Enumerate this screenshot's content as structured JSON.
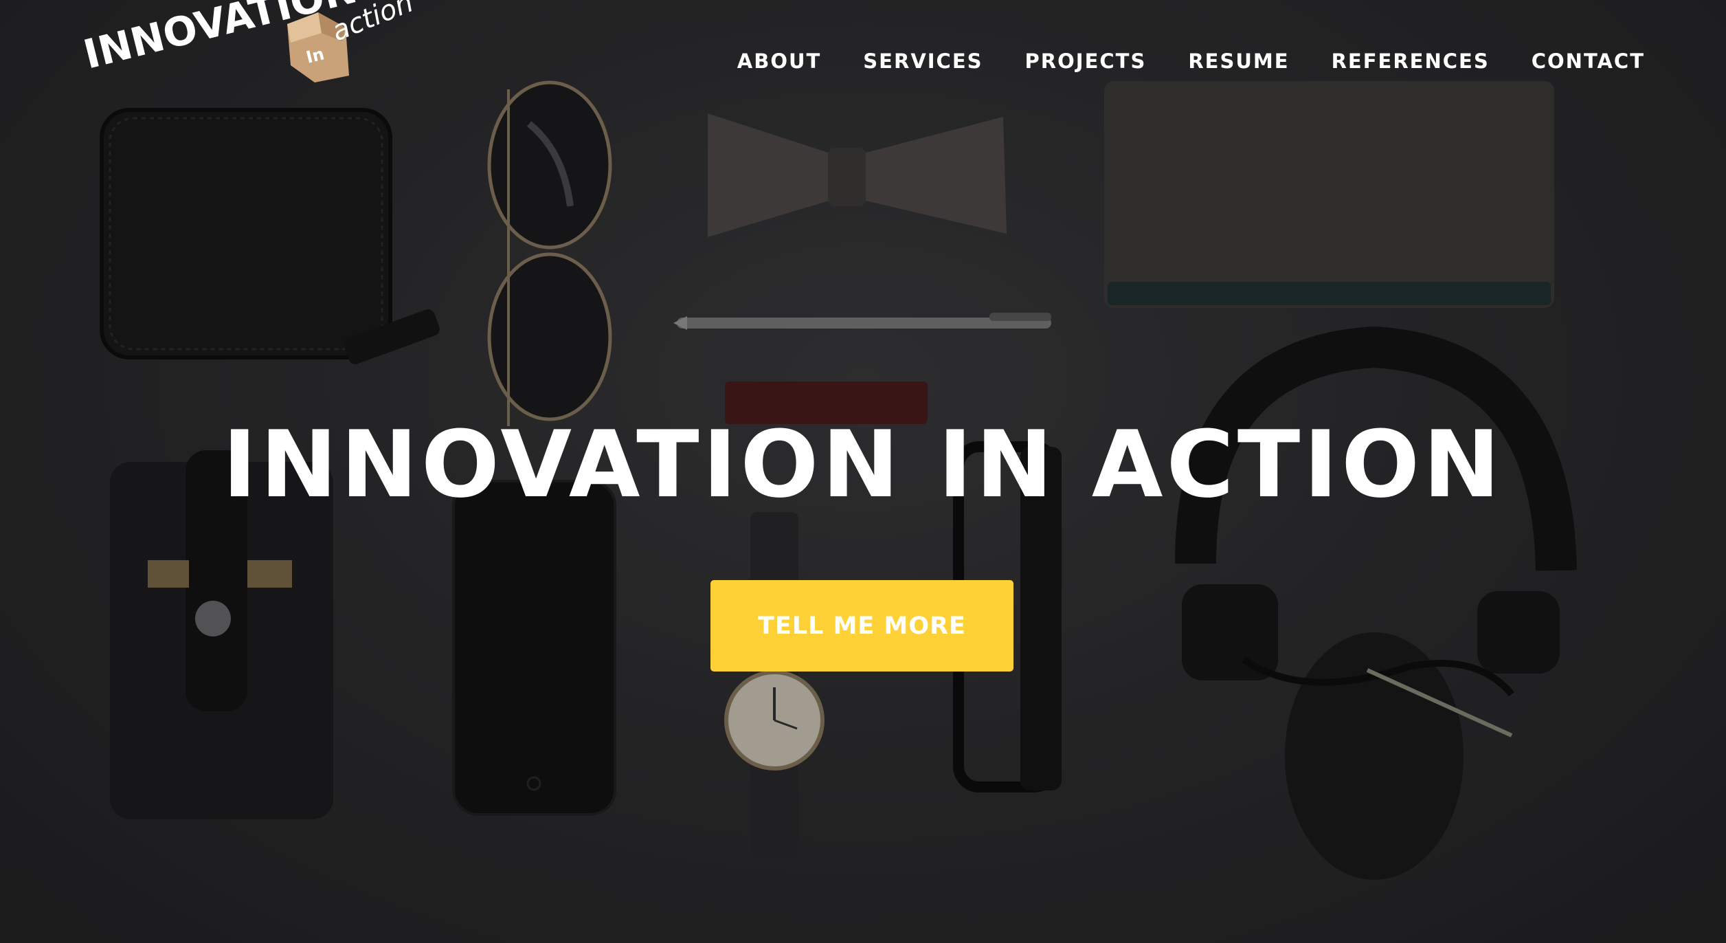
{
  "logo": {
    "word_main": "INNOVATION",
    "word_in": "In",
    "word_action": "action"
  },
  "nav": {
    "items": [
      {
        "label": "ABOUT"
      },
      {
        "label": "SERVICES"
      },
      {
        "label": "PROJECTS"
      },
      {
        "label": "RESUME"
      },
      {
        "label": "REFERENCES"
      },
      {
        "label": "CONTACT"
      }
    ]
  },
  "hero": {
    "headline": "INNOVATION IN ACTION",
    "cta_label": "TELL ME MORE",
    "background_items": [
      "wallet",
      "aviator-sunglasses",
      "bow-tie",
      "pen",
      "notebook",
      "lip-balm",
      "phone-sleeve",
      "smartphone",
      "wristwatch",
      "eyeglasses",
      "headphones"
    ]
  },
  "colors": {
    "accent": "#fed136",
    "background": "#2b2b2d",
    "text": "#ffffff"
  }
}
